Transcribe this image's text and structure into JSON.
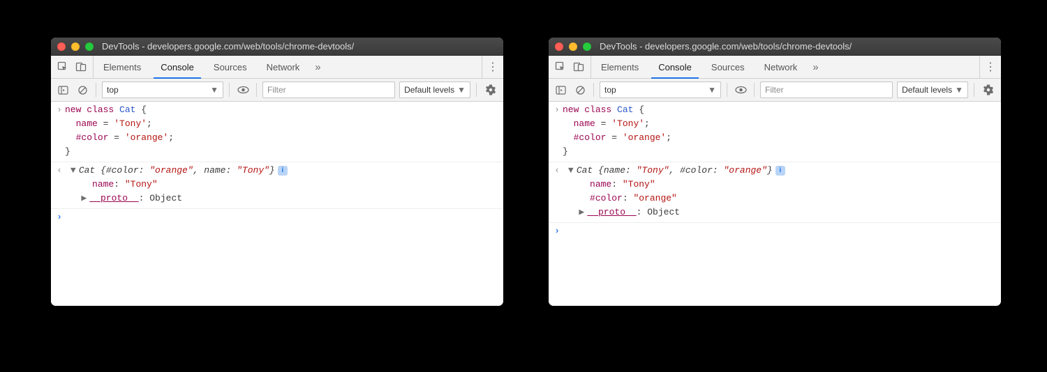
{
  "window_title": "DevTools - developers.google.com/web/tools/chrome-devtools/",
  "tabs": [
    "Elements",
    "Console",
    "Sources",
    "Network"
  ],
  "active_tab_index": 1,
  "context_selector": "top",
  "filter_placeholder": "Filter",
  "levels_label": "Default levels",
  "input_code": {
    "l1_kw1": "new",
    "l1_kw2": "class",
    "l1_cls": "Cat",
    "l1_brace": "{",
    "l2_prop": "name",
    "l2_eq": " = ",
    "l2_str": "'Tony'",
    "l2_semi": ";",
    "l3_prop": "#color",
    "l3_eq": " = ",
    "l3_str": "'orange'",
    "l3_semi": ";",
    "l4_brace": "}"
  },
  "left": {
    "summary_cls": "Cat",
    "summary_open": " {",
    "summary_k1": "#color",
    "summary_colon": ": ",
    "summary_v1": "\"orange\"",
    "summary_comma": ", ",
    "summary_k2": "name",
    "summary_v2": "\"Tony\"",
    "summary_close": "}",
    "prop_name_key": "name",
    "prop_name_colon": ": ",
    "prop_name_val": "\"Tony\"",
    "proto_key": "__proto__",
    "proto_colon": ": ",
    "proto_val": "Object"
  },
  "right": {
    "summary_cls": "Cat",
    "summary_open": " {",
    "summary_k1": "name",
    "summary_colon": ": ",
    "summary_v1": "\"Tony\"",
    "summary_comma": ", ",
    "summary_k2": "#color",
    "summary_v2": "\"orange\"",
    "summary_close": "}",
    "prop_name_key": "name",
    "prop_name_colon": ": ",
    "prop_name_val": "\"Tony\"",
    "prop_color_key": "#color",
    "prop_color_colon": ": ",
    "prop_color_val": "\"orange\"",
    "proto_key": "__proto__",
    "proto_colon": ": ",
    "proto_val": "Object"
  }
}
